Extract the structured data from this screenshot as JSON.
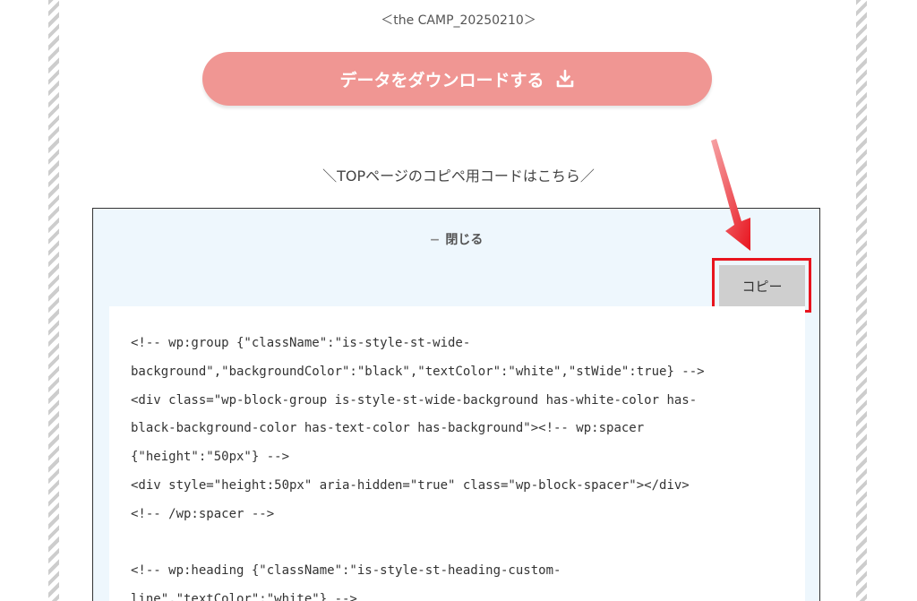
{
  "caption": "＜the CAMP_20250210＞",
  "download_button": {
    "label": "データをダウンロードする",
    "icon": "download-icon",
    "color": "#f09693"
  },
  "top_code_label": "＼TOPページのコピペ用コードはこちら／",
  "code_panel": {
    "toggle_label": "閉じる",
    "toggle_icon": "minus-icon",
    "copy_label": "コピー",
    "highlight_color": "#e8141e",
    "code_lines": [
      "<!-- wp:group {\"className\":\"is-style-st-wide-",
      "background\",\"backgroundColor\":\"black\",\"textColor\":\"white\",\"stWide\":true} -->",
      "<div class=\"wp-block-group is-style-st-wide-background has-white-color has-",
      "black-background-color has-text-color has-background\"><!-- wp:spacer",
      "{\"height\":\"50px\"} -->",
      "<div style=\"height:50px\" aria-hidden=\"true\" class=\"wp-block-spacer\"></div>",
      "<!-- /wp:spacer -->",
      "",
      "<!-- wp:heading {\"className\":\"is-style-st-heading-custom-",
      "line\",\"textColor\":\"white\"} -->"
    ]
  },
  "annotation_arrow_color": "#e8141e"
}
